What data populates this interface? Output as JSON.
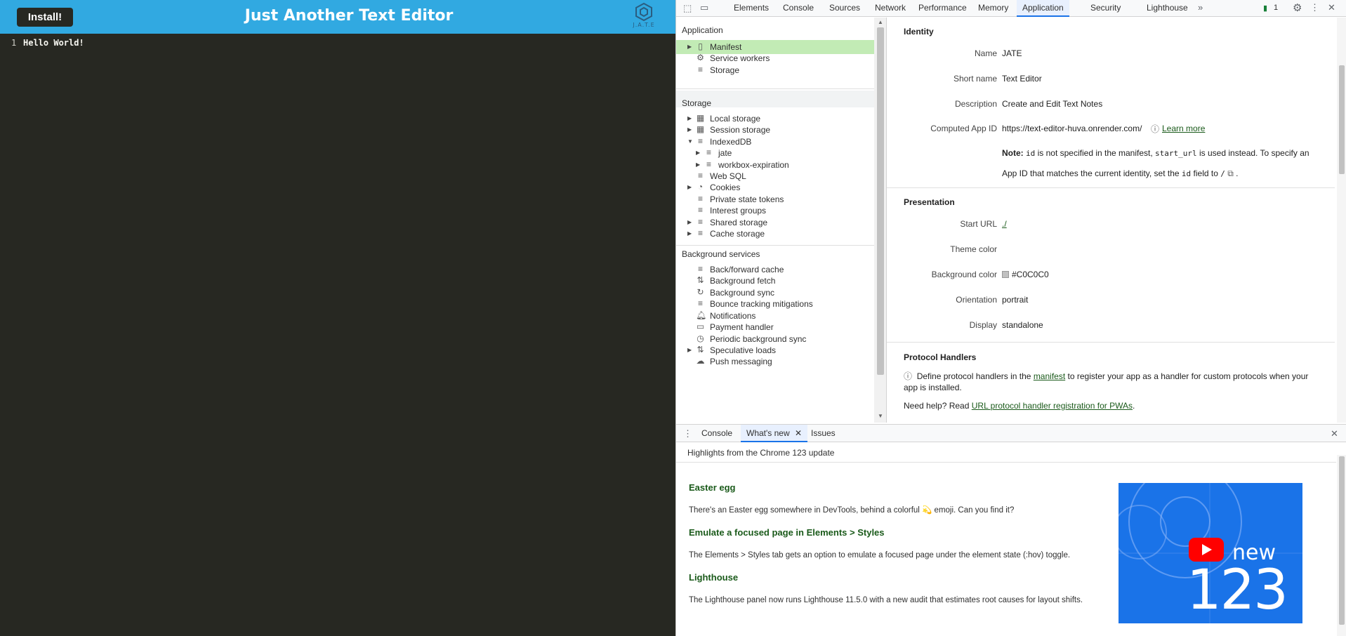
{
  "app": {
    "install_label": "Install!",
    "title": "Just Another Text Editor",
    "logo_text": "J.A.T.E",
    "editor_line_number": "1",
    "editor_text": "Hello World!"
  },
  "devtools": {
    "tabs": [
      "Elements",
      "Console",
      "Sources",
      "Network",
      "Performance",
      "Memory",
      "Application",
      "Security",
      "Lighthouse"
    ],
    "active_tab": "Application",
    "message_count": "1",
    "sidebar": {
      "application_title": "Application",
      "application_items": [
        "Manifest",
        "Service workers",
        "Storage"
      ],
      "storage_title": "Storage",
      "storage_items": [
        "Local storage",
        "Session storage",
        "IndexedDB",
        "jate",
        "workbox-expiration",
        "Web SQL",
        "Cookies",
        "Private state tokens",
        "Interest groups",
        "Shared storage",
        "Cache storage"
      ],
      "background_title": "Background services",
      "background_items": [
        "Back/forward cache",
        "Background fetch",
        "Background sync",
        "Bounce tracking mitigations",
        "Notifications",
        "Payment handler",
        "Periodic background sync",
        "Speculative loads",
        "Push messaging"
      ]
    },
    "manifest": {
      "identity_title": "Identity",
      "name_label": "Name",
      "name_value": "JATE",
      "short_name_label": "Short name",
      "short_name_value": "Text Editor",
      "description_label": "Description",
      "description_value": "Create and Edit Text Notes",
      "app_id_label": "Computed App ID",
      "app_id_value": "https://text-editor-huva.onrender.com/",
      "learn_more": "Learn more",
      "note_label": "Note:",
      "note_id": "id",
      "note_text_1": "is not specified in the manifest,",
      "note_start_url": "start_url",
      "note_text_2": "is used instead. To specify",
      "note_text_3": "an App ID that matches the current identity, set the",
      "note_field": "id",
      "note_text_4": "field to",
      "note_slash": "/",
      "presentation_title": "Presentation",
      "start_url_label": "Start URL",
      "start_url_value": "./",
      "theme_color_label": "Theme color",
      "bg_color_label": "Background color",
      "bg_color_value": "#C0C0C0",
      "orientation_label": "Orientation",
      "orientation_value": "portrait",
      "display_label": "Display",
      "display_value": "standalone",
      "protocol_title": "Protocol Handlers",
      "protocol_text_1": "Define protocol handlers in the",
      "protocol_link": "manifest",
      "protocol_text_2": "to register your app as a handler for custom protocols when",
      "protocol_text_3": "your app is installed.",
      "help_text": "Need help? Read",
      "help_link": "URL protocol handler registration for PWAs",
      "help_end": "."
    },
    "drawer": {
      "tabs": [
        "Console",
        "What's new",
        "Issues"
      ],
      "active_tab": "What's new",
      "subtitle": "Highlights from the Chrome 123 update",
      "items": [
        {
          "title": "Easter egg",
          "body": "There's an Easter egg somewhere in DevTools, behind a colorful 💫 emoji. Can you find it?"
        },
        {
          "title": "Emulate a focused page in Elements > Styles",
          "body": "The Elements > Styles tab gets an option to emulate a focused page under the element state (:hov) toggle."
        },
        {
          "title": "Lighthouse",
          "body": "The Lighthouse panel now runs Lighthouse 11.5.0 with a new audit that estimates root causes for layout shifts."
        }
      ],
      "video_new": "new",
      "video_number": "123"
    }
  },
  "colors": {
    "app_header": "#31a9e1",
    "editor_bg": "#272822",
    "selected_item": "#c2ebb5",
    "link": "#1a5a1a",
    "video_bg": "#1a73e8"
  }
}
